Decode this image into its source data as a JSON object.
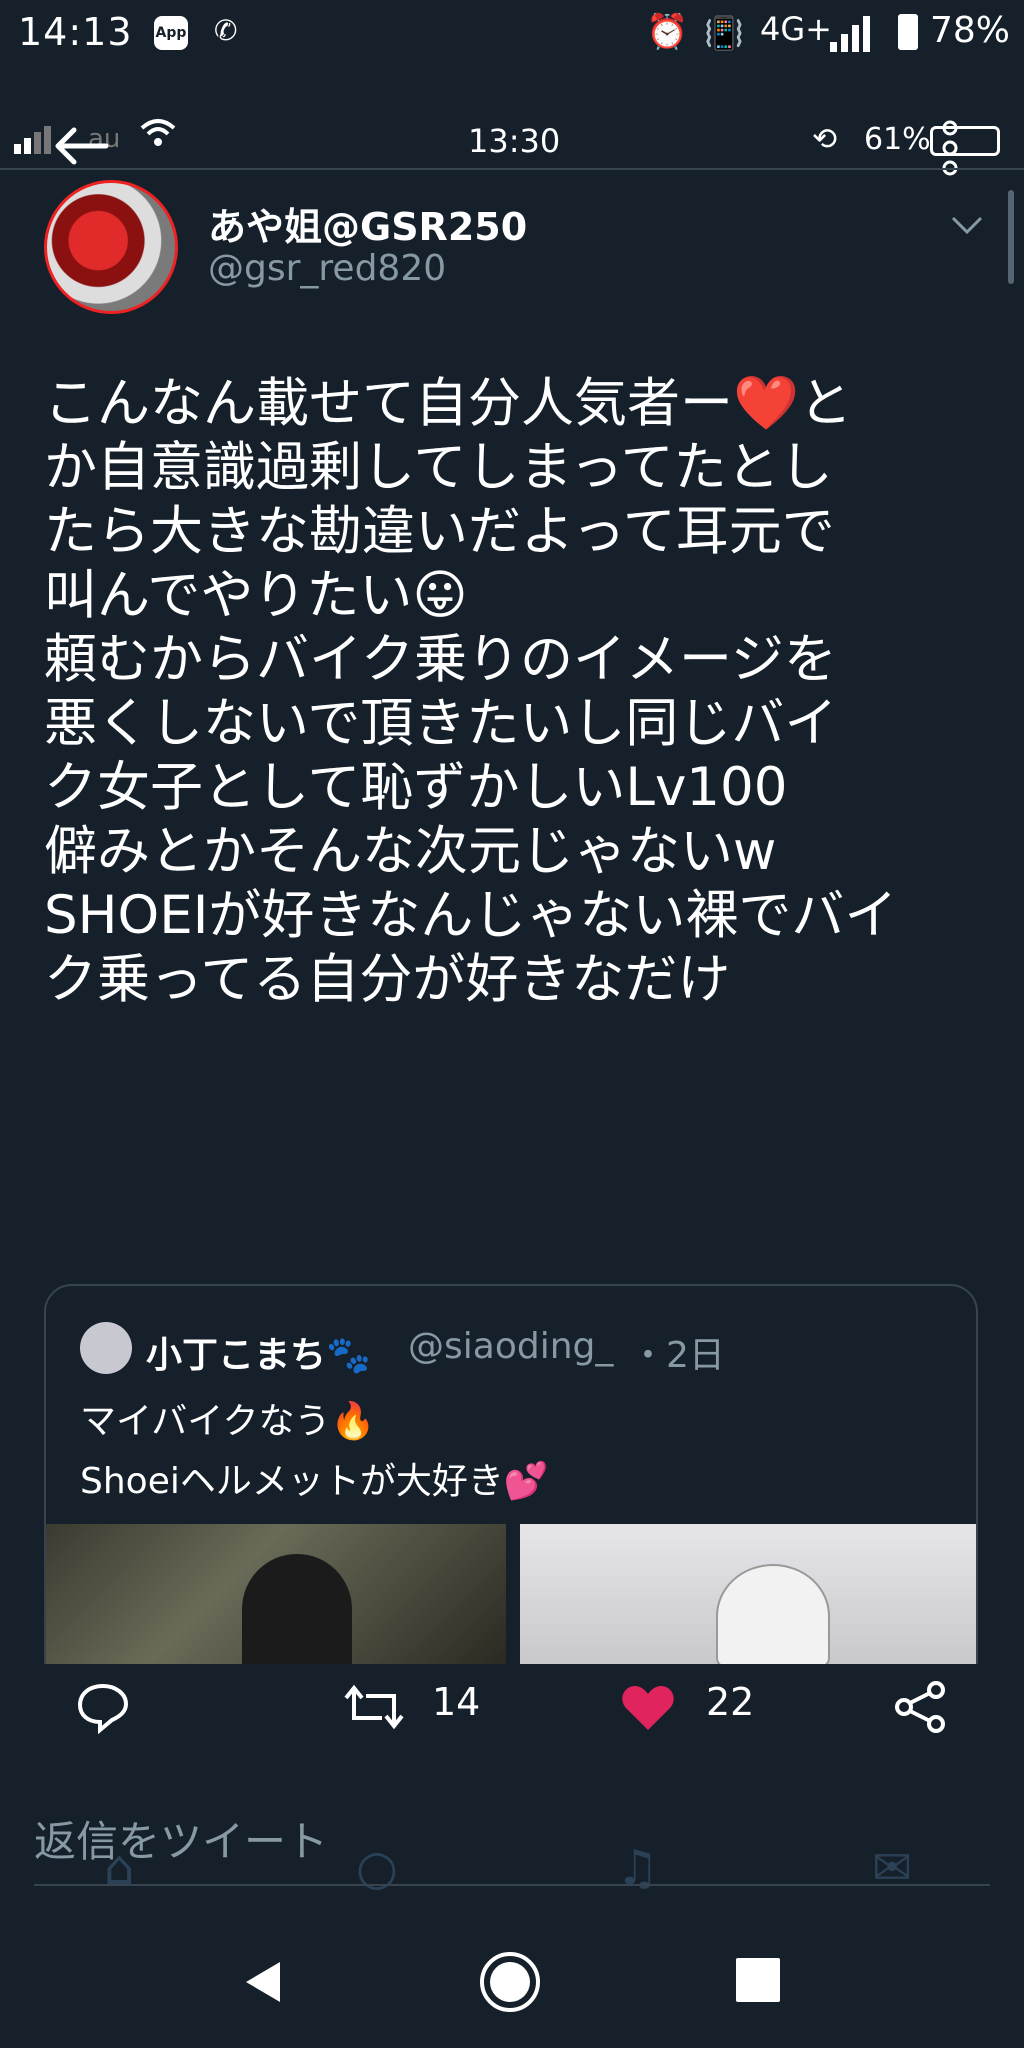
{
  "outer_status": {
    "time": "14:13",
    "app_badge": "App",
    "network": "4G+",
    "battery": "78%"
  },
  "inner_status": {
    "carrier": "au",
    "time": "13:30",
    "battery": "61%"
  },
  "tweet": {
    "display_name": "あや姐@GSR250",
    "handle": "@gsr_red820",
    "body": "こんなん載せて自分人気者ー❤️と\nか自意識過剰してしまってたとし\nたら大きな勘違いだよって耳元で\n叫んでやりたい😛\n頼むからバイク乗りのイメージを\n悪くしないで頂きたいし同じバイ\nク女子として恥ずかしいLv100\n僻みとかそんな次元じゃないw\nSHOEIが好きなんじゃない裸でバイ\nク乗ってる自分が好きなだけ"
  },
  "quoted": {
    "name": "小丁こまち🐾",
    "handle": "@siaoding_",
    "time": "・2日",
    "text": "マイバイクなう🔥\nShoeiヘルメットが大好き💕"
  },
  "actions": {
    "retweets": "14",
    "likes": "22"
  },
  "reply_placeholder": "返信をツイート",
  "colors": {
    "background": "#15202b",
    "secondary_text": "#8899a6",
    "like": "#e0245e",
    "divider": "#38444d"
  }
}
